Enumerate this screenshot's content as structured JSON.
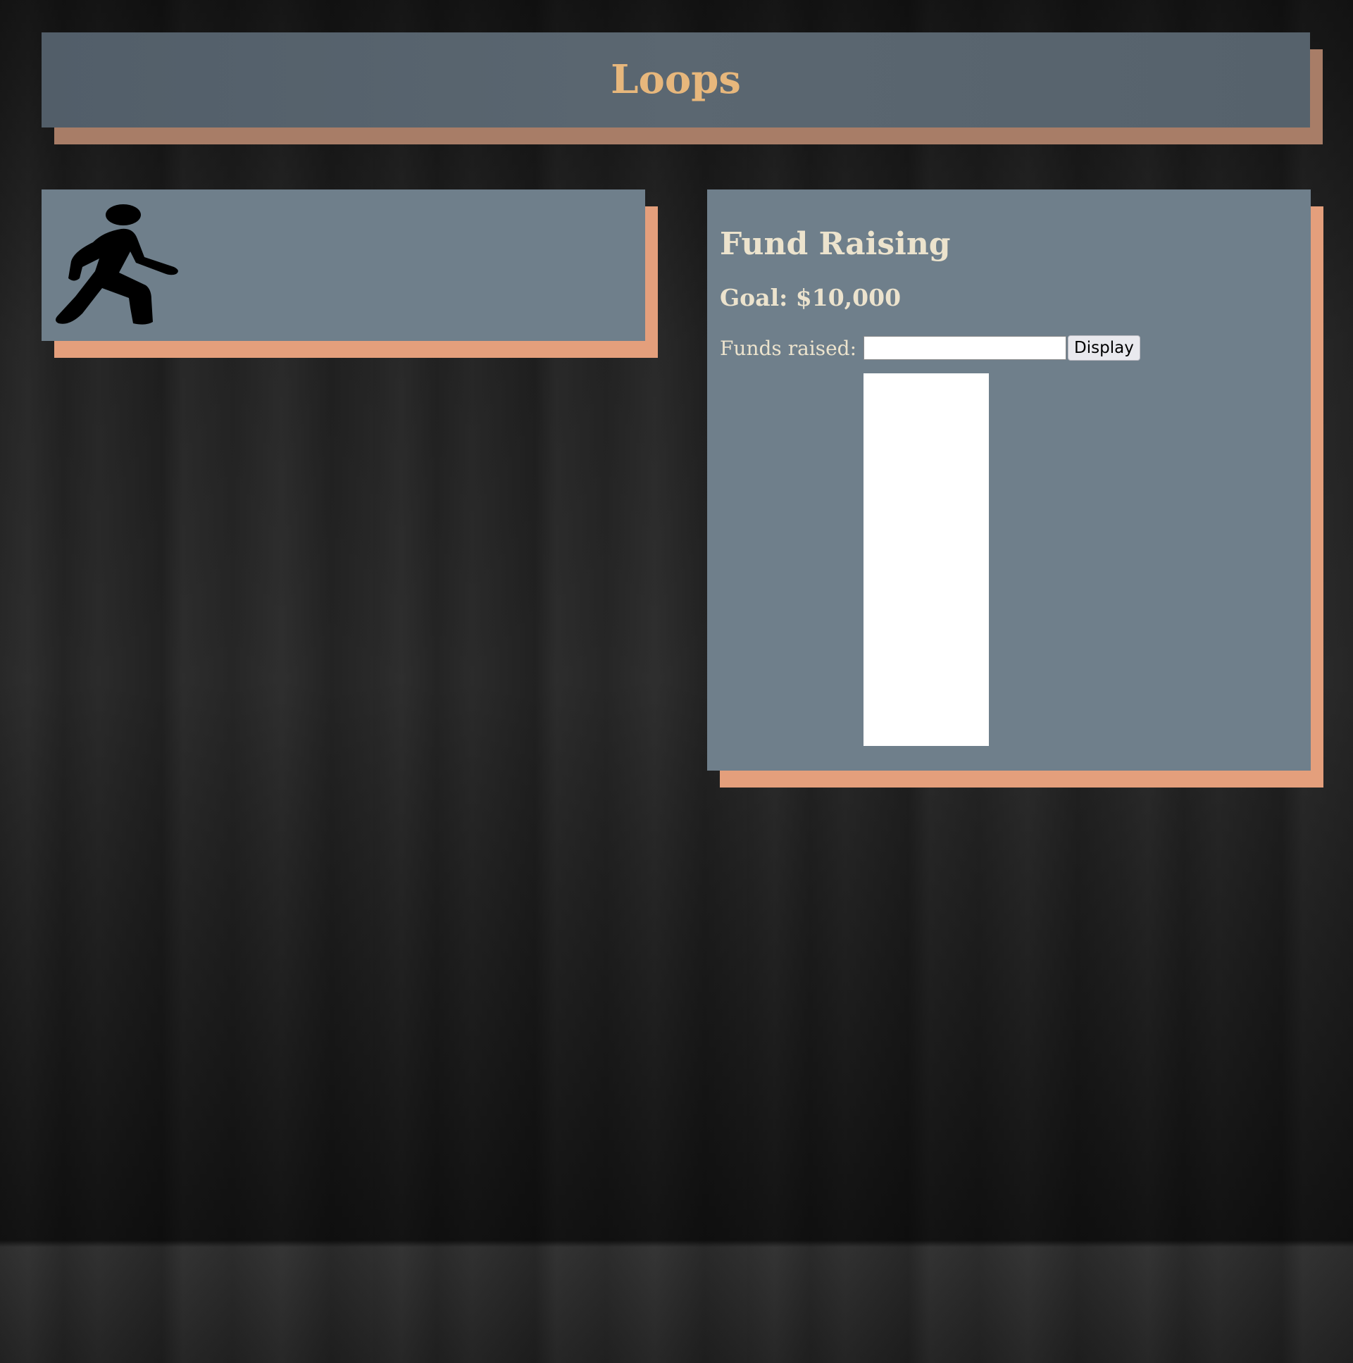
{
  "header": {
    "title": "Loops"
  },
  "left_panel": {
    "icon": "walking-person-icon"
  },
  "fund_raising": {
    "title": "Fund Raising",
    "goal": "Goal: $10,000",
    "funds_label": "Funds raised:",
    "funds_value": "",
    "funds_placeholder": "",
    "button_label": "Display",
    "progress_fraction": 0
  },
  "colors": {
    "panel": "#6f7f8b",
    "header": "#57636d",
    "title": "#e7b77c",
    "text": "#ece3cd",
    "shadow_accent": "#e49f7c",
    "header_shadow": "#a87d67"
  }
}
